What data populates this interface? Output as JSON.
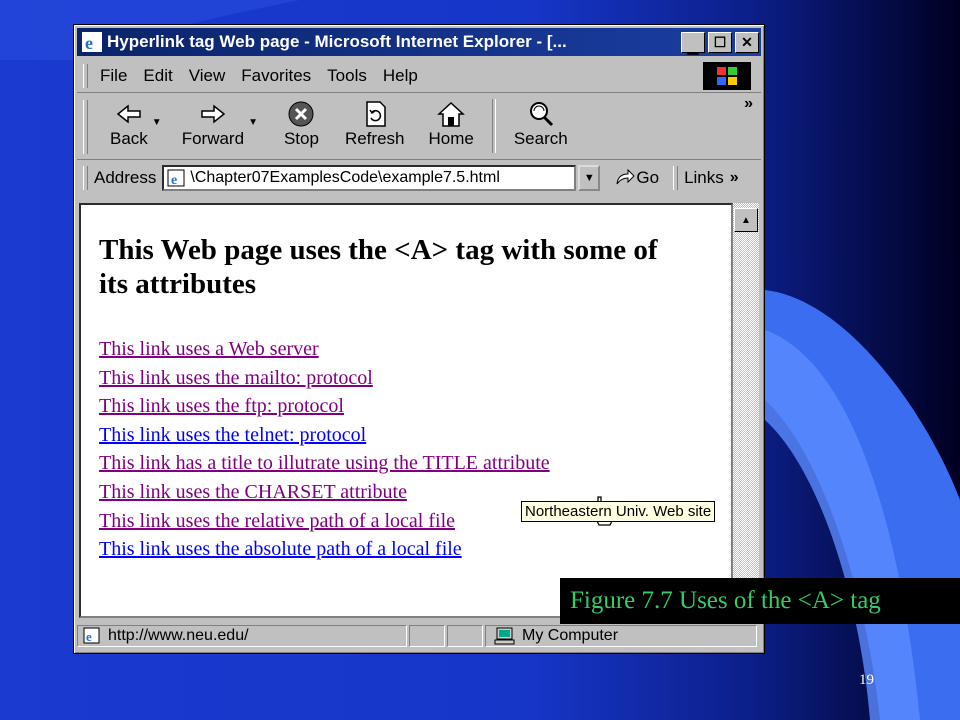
{
  "window": {
    "title": "Hyperlink tag Web page - Microsoft Internet Explorer - [...",
    "buttons": [
      "minimize",
      "maximize",
      "close"
    ]
  },
  "menu": [
    "File",
    "Edit",
    "View",
    "Favorites",
    "Tools",
    "Help"
  ],
  "toolbar": {
    "back": "Back",
    "forward": "Forward",
    "stop": "Stop",
    "refresh": "Refresh",
    "home": "Home",
    "search": "Search",
    "more": "»"
  },
  "address": {
    "label": "Address",
    "value": "\\Chapter07ExamplesCode\\example7.5.html",
    "go": "Go",
    "links": "Links",
    "more": "»"
  },
  "page": {
    "heading": "This Web page uses the <A> tag with some of its attributes",
    "links": [
      {
        "text": "This link uses a Web server",
        "visited": true
      },
      {
        "text": "This link uses the mailto: protocol",
        "visited": true
      },
      {
        "text": "This link uses the ftp: protocol",
        "visited": true
      },
      {
        "text": "This link uses the telnet: protocol",
        "visited": false
      },
      {
        "text": "This link has a title to illutrate using the TITLE attribute",
        "visited": true
      },
      {
        "text": "This link uses the CHARSET attribute",
        "visited": true
      },
      {
        "text": "This link uses the relative path of a local file",
        "visited": true
      },
      {
        "text": "This link uses the absolute path of a local file",
        "visited": false
      }
    ],
    "tooltip": "Northeastern Univ. Web site"
  },
  "status": {
    "url": "http://www.neu.edu/",
    "zone": "My Computer"
  },
  "slide": {
    "caption": "Figure 7.7 Uses of the <A> tag",
    "page_number": "19"
  },
  "colors": {
    "visited_link": "#800080",
    "unvisited_link": "#0000ff",
    "caption_text": "#33cc66",
    "title_bar": "#0a246a"
  }
}
